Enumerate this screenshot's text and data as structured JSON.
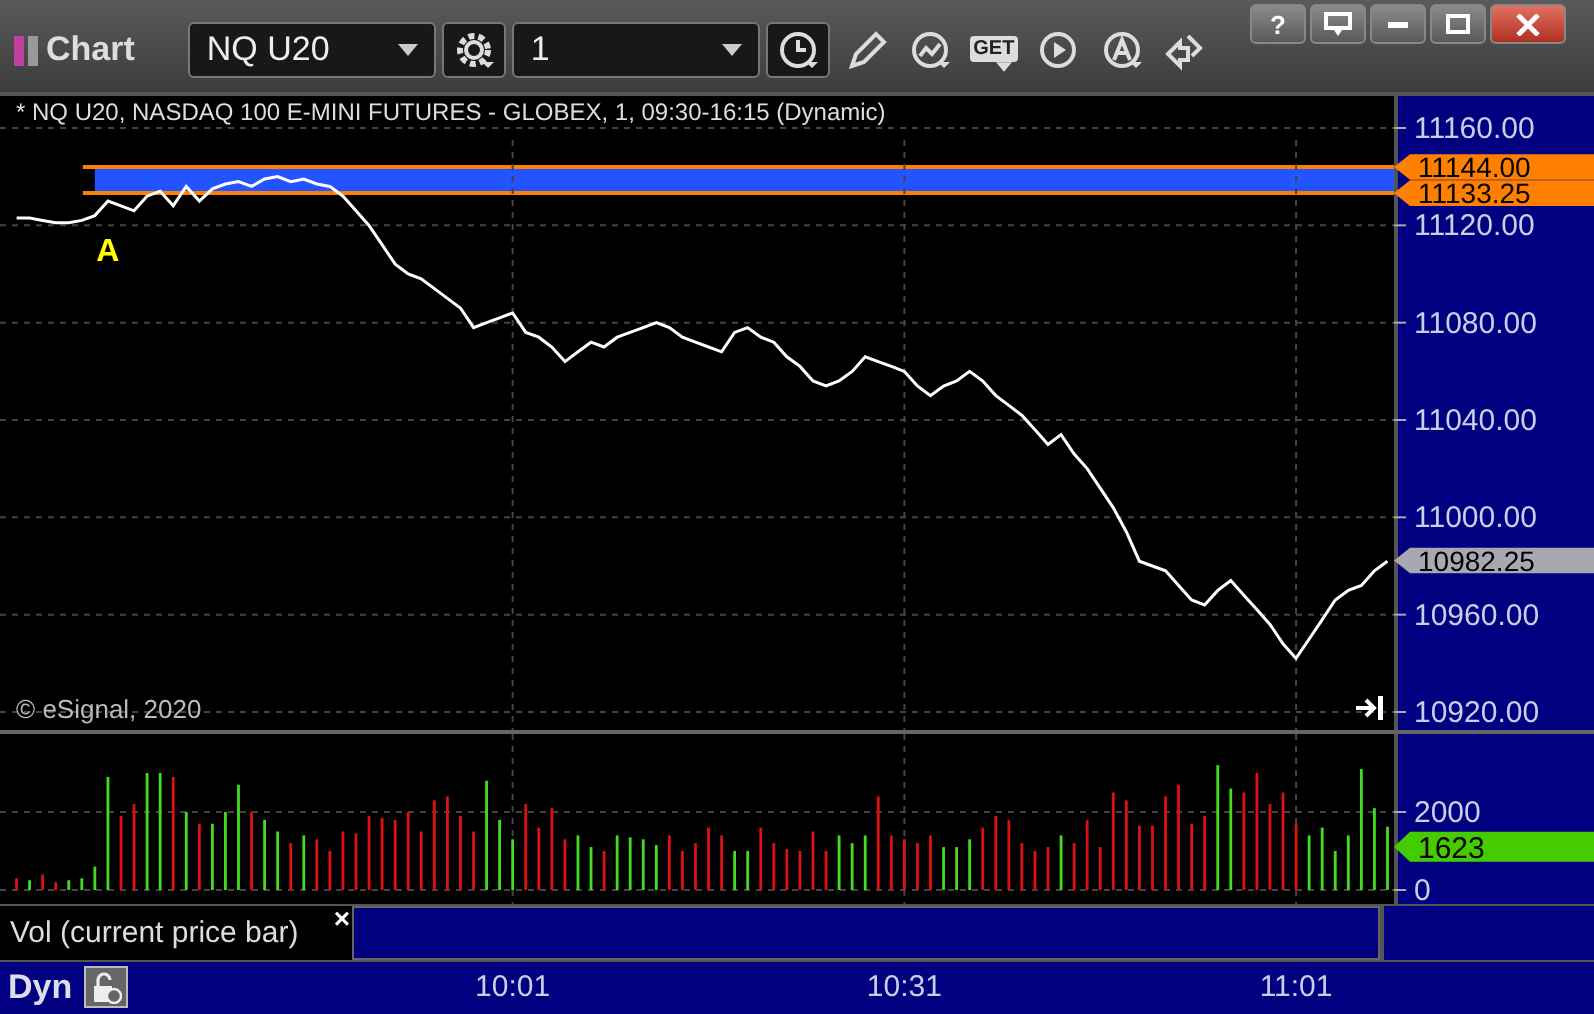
{
  "window": {
    "title": "Chart",
    "controls": [
      {
        "kind": "help",
        "label": "?"
      },
      {
        "kind": "restore"
      },
      {
        "kind": "minimize"
      },
      {
        "kind": "maximize"
      },
      {
        "kind": "close"
      }
    ]
  },
  "toolbar": {
    "symbol_field": {
      "value": "NQ U20"
    },
    "interval_field": {
      "value": "1"
    },
    "buttons": [
      {
        "kind": "gear"
      },
      {
        "kind": "clock"
      },
      {
        "kind": "pencil"
      },
      {
        "kind": "studies"
      },
      {
        "kind": "get",
        "label": "GET"
      },
      {
        "kind": "play"
      },
      {
        "kind": "alert"
      },
      {
        "kind": "link"
      }
    ]
  },
  "price_chart": {
    "legend": "* NQ U20, NASDAQ 100 E-MINI FUTURES - GLOBEX, 1, 09:30-16:15 (Dynamic)",
    "copyright": "© eSignal, 2020",
    "chart_data": {
      "type": "line",
      "ylim": [
        10912.6,
        11173.15
      ],
      "series": [
        {
          "color": "#ffffff",
          "values": [
            11123,
            11123,
            11122,
            11121,
            11121,
            11122,
            11124,
            11130,
            11128,
            11126,
            11132,
            11134,
            11128,
            11136,
            11130,
            11135,
            11137,
            11138,
            11136,
            11139,
            11140,
            11138,
            11139,
            11137,
            11136,
            11132,
            11126,
            11120,
            11112,
            11104,
            11100,
            11098,
            11094,
            11090,
            11086,
            11078,
            11080,
            11082,
            11084,
            11076,
            11074,
            11070,
            11064,
            11068,
            11072,
            11070,
            11074,
            11076,
            11078,
            11080,
            11078,
            11074,
            11072,
            11070,
            11068,
            11076,
            11078,
            11074,
            11072,
            11066,
            11062,
            11056,
            11054,
            11056,
            11060,
            11066,
            11064,
            11062,
            11060,
            11054,
            11050,
            11054,
            11056,
            11060,
            11056,
            11050,
            11046,
            11042,
            11036,
            11030,
            11034,
            11026,
            11020,
            11012,
            11004,
            10994,
            10982,
            10980,
            10978,
            10972,
            10966,
            10964,
            10970,
            10974,
            10968,
            10962,
            10956,
            10948,
            10942,
            10950,
            10958,
            10966,
            10970,
            10972,
            10978,
            10982
          ]
        }
      ],
      "yticks": [
        {
          "value": 11160,
          "label": "11160.00"
        },
        {
          "value": 11120,
          "label": "11120.00"
        },
        {
          "value": 11080,
          "label": "11080.00"
        },
        {
          "value": 11040,
          "label": "11040.00"
        },
        {
          "value": 11000,
          "label": "11000.00"
        },
        {
          "value": 10960,
          "label": "10960.00"
        },
        {
          "value": 10920,
          "label": "10920.00"
        }
      ],
      "grid": true,
      "annotations": [
        {
          "text": "A"
        }
      ]
    },
    "price_tags": [
      {
        "label": "11144.00",
        "color": "#ff8000"
      },
      {
        "label": "11133.25",
        "color": "#ff8000"
      },
      {
        "label": "10982.25",
        "color": "#a8a8b0"
      }
    ]
  },
  "volume_chart": {
    "chart_data": {
      "type": "bar",
      "ylim": [
        0,
        4000
      ],
      "series": [
        {
          "color": "#44dd22",
          "values": [
            null,
            250,
            null,
            null,
            250,
            300,
            600,
            2900,
            null,
            null,
            3000,
            3000,
            null,
            2000,
            null,
            1700,
            2000,
            2700,
            null,
            1800,
            1500,
            null,
            1400,
            null,
            null,
            null,
            null,
            null,
            null,
            null,
            null,
            null,
            null,
            null,
            null,
            null,
            2800,
            1800,
            1300,
            null,
            null,
            null,
            null,
            1400,
            1100,
            null,
            1400,
            1350,
            1300,
            1150,
            null,
            null,
            null,
            null,
            null,
            1000,
            1000,
            null,
            null,
            null,
            null,
            null,
            null,
            1400,
            1200,
            1400,
            null,
            null,
            null,
            null,
            null,
            1100,
            1100,
            1300,
            null,
            null,
            null,
            null,
            null,
            null,
            1400,
            null,
            null,
            null,
            null,
            null,
            null,
            null,
            null,
            null,
            null,
            null,
            3200,
            2600,
            null,
            null,
            null,
            null,
            null,
            1400,
            1600,
            1000,
            1400,
            3100,
            2100,
            1623
          ]
        },
        {
          "color": "#dd1111",
          "values": [
            300,
            null,
            400,
            200,
            null,
            null,
            null,
            null,
            1900,
            2200,
            null,
            null,
            2900,
            null,
            1700,
            null,
            null,
            null,
            2000,
            null,
            null,
            1200,
            null,
            1300,
            1000,
            1500,
            1450,
            1900,
            1850,
            1800,
            2000,
            1500,
            2300,
            2400,
            1900,
            1500,
            null,
            null,
            null,
            2200,
            1600,
            2100,
            1300,
            null,
            null,
            1000,
            null,
            null,
            null,
            null,
            1400,
            1000,
            1200,
            1600,
            1400,
            null,
            null,
            1600,
            1200,
            1050,
            1000,
            1500,
            1000,
            null,
            null,
            null,
            2400,
            1400,
            1300,
            1200,
            1400,
            null,
            null,
            null,
            1600,
            1900,
            1800,
            1200,
            1000,
            1100,
            null,
            1200,
            1800,
            1100,
            2500,
            2300,
            1650,
            1650,
            2400,
            2700,
            1700,
            1900,
            null,
            null,
            2500,
            3000,
            2200,
            2500,
            1700,
            null,
            null,
            null,
            null,
            null,
            null,
            null
          ]
        }
      ],
      "yticks": [
        {
          "value": 2000,
          "label": "2000"
        },
        {
          "value": 0,
          "label": "0"
        }
      ],
      "grid": true
    },
    "price_tags": [
      {
        "label": "1623",
        "color": "#44cc00"
      }
    ]
  },
  "indicator": {
    "label": "Vol (current price bar)",
    "close": "×"
  },
  "time_axis": {
    "mode": "Dyn",
    "labels": [
      "10:01",
      "10:31",
      "11:01"
    ]
  }
}
